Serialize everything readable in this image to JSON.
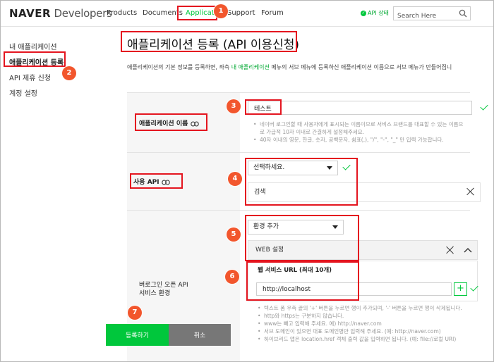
{
  "header": {
    "logo_bold": "NAVER",
    "logo_rest": "Developers",
    "nav": [
      "Products",
      "Documents",
      "Application",
      "Support",
      "Forum"
    ],
    "api_status": "API 상태",
    "search_placeholder": "Search Here"
  },
  "sidebar": {
    "items": [
      {
        "label": "내 애플리케이션"
      },
      {
        "label": "애플리케이션 등록"
      },
      {
        "label": "API 제휴 신청"
      },
      {
        "label": "계정 설정"
      }
    ]
  },
  "main": {
    "title": "애플리케이션 등록 (API 이용신청)",
    "description_before": "애플리케이션의 기본 정보를 등록하면, 좌측 ",
    "description_link": "내 애플리케이션",
    "description_after": " 메뉴의 서브 메뉴에 등록하신 애플리케이션 이름으로 서브 메뉴가 만들어집니",
    "app_name": {
      "label": "애플리케이션 이름",
      "link_icon": "link-icon",
      "value": "테스트",
      "help": [
        "네이버 로그인할 때 사용자에게 표시되는 이름이므로 서비스 브랜드를 대표할 수 있는 이름으로 가급적 10자 이내로 간결하게 설정해주세요.",
        "40자 이내의 영문, 한글, 숫자, 공백문자, 쉼표(,), \"/\", \"-\", \"_\" 만 입력 가능합니다."
      ]
    },
    "api": {
      "label": "사용 API",
      "link_icon": "link-icon",
      "select_value": "선택하세요.",
      "selected_item": "검색"
    },
    "env": {
      "label_line1": "버로그인 오픈 API",
      "label_line2": "서비스 환경",
      "select_value": "환경 추가",
      "section_title": "WEB 설정",
      "url_label": "웹 서비스 URL (최대 10개)",
      "url_value": "http://localhost",
      "add_symbol": "+",
      "help": [
        "텍스트 폼 우측 끝의 '+' 버튼을 누르면 행이 추가되며, '-' 버튼을 누르면 행이 삭제됩니다.",
        "http와 https는 구분하지 않습니다.",
        "www는 빼고 입력해 주세요. 예) http://naver.com",
        "서브 도메인이 있으면 대표 도메인명만 입력해 주세요. (예: http://naver.com)",
        "하이브리드 앱은 location.href 객체 출력 값을 입력하면 됩니다. (예: file://로컬 URI)"
      ]
    },
    "buttons": {
      "register": "등록하기",
      "cancel": "취소"
    }
  },
  "annotations": [
    "1",
    "2",
    "3",
    "4",
    "5",
    "6",
    "7"
  ],
  "colors": {
    "brand_green": "#00c73c",
    "highlight_red": "#e4151f",
    "badge_orange": "#f2562d"
  }
}
